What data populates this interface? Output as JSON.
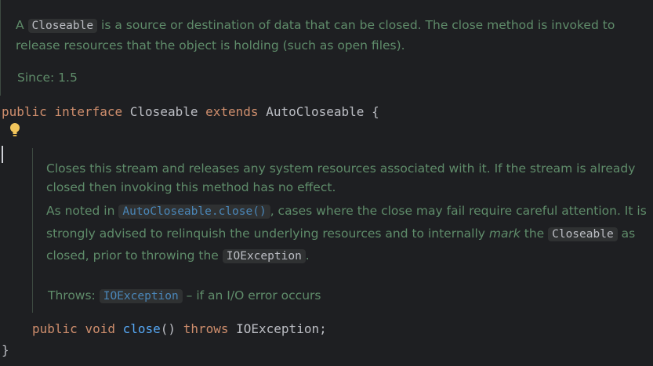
{
  "class_doc": {
    "line1_prefix": "A ",
    "line1_code": "Closeable",
    "line1_suffix": " is a source or destination of data that can be closed. The close method is invoked to",
    "line2": "release resources that the object is holding (such as open files).",
    "since": "Since: 1.5"
  },
  "declaration": {
    "kw_public": "public",
    "kw_interface": "interface",
    "name": "Closeable",
    "kw_extends": "extends",
    "parent": "AutoCloseable",
    "brace_open": "{",
    "brace_close": "}"
  },
  "method_doc": {
    "p1_line1": "Closes this stream and releases any system resources associated with it. If the stream is already",
    "p1_line2": "closed then invoking this method has no effect.",
    "p2_line1_prefix": "As noted in ",
    "p2_line1_link": "AutoCloseable.close()",
    "p2_line1_suffix": ", cases where the close may fail require careful attention. It is",
    "p2_line2_prefix": "strongly advised to relinquish the underlying resources and to internally ",
    "p2_line2_em": "mark",
    "p2_line2_mid": " the ",
    "p2_line2_code": "Closeable",
    "p2_line2_suffix": " as",
    "p2_line3_prefix": "closed, prior to throwing the ",
    "p2_line3_code": "IOException",
    "p2_line3_suffix": ".",
    "throws_label": "Throws: ",
    "throws_link": "IOException",
    "throws_desc": " – if an I/O error occurs"
  },
  "method": {
    "kw_public": "public",
    "kw_void": "void",
    "name": "close",
    "parens": "()",
    "kw_throws": "throws",
    "exception": "IOException",
    "terminator": ";"
  },
  "icons": {
    "intention": "lightbulb-icon",
    "caret": "text-caret"
  },
  "colors": {
    "background": "#1e1f22",
    "doc_text": "#5f8c6a",
    "keyword": "#cf8e6d",
    "function": "#56a8f5",
    "identifier": "#bcbec4",
    "link": "#4a86b8",
    "bulb": "#f2c55c"
  }
}
